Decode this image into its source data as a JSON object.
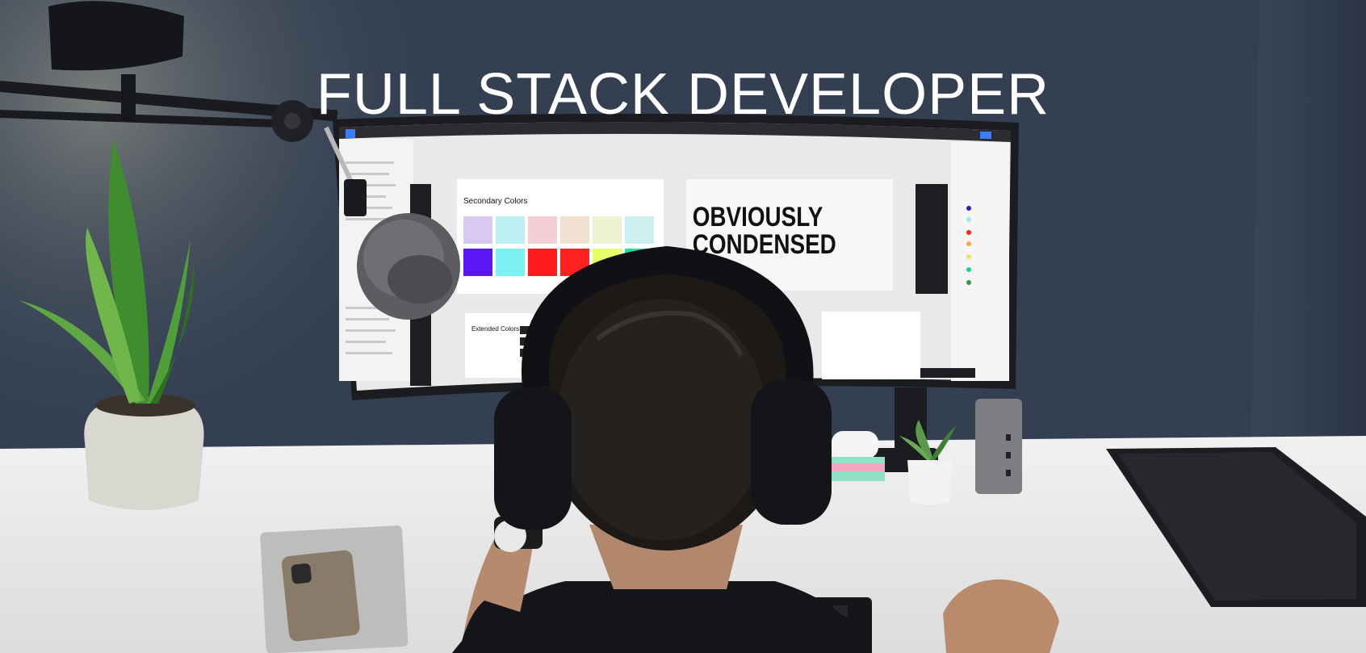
{
  "hero": {
    "title": "FULL STACK DEVELOPER"
  },
  "screen": {
    "panel1_title": "Secondary Colors",
    "panel2_title": "OBVIOUSLY CONDENSED",
    "panel3_title": "Extended Colors",
    "swatches_top": [
      "#d9c9f2",
      "#bff1f4",
      "#f6cfd6",
      "#f1dfcf",
      "#eef2cf",
      "#cfeef0"
    ],
    "swatches_bottom": [
      "#5a16f5",
      "#7cf2f2",
      "#ff1c1c",
      "#ff2020",
      "#e6ff6a",
      "#19e2a0"
    ]
  },
  "photo": {
    "colors": {
      "wall": "#344052",
      "desk": "#ececec",
      "plant": "#3f8d2e",
      "monitor_frame": "#1a1c20",
      "screen_bg": "#eaeaea"
    },
    "objects": [
      "desk-lamp-icon",
      "microphone-icon",
      "plant-icon",
      "headphones-icon",
      "laptop-icon",
      "phone-icon",
      "keyboard-icon",
      "mouse-icon"
    ]
  }
}
